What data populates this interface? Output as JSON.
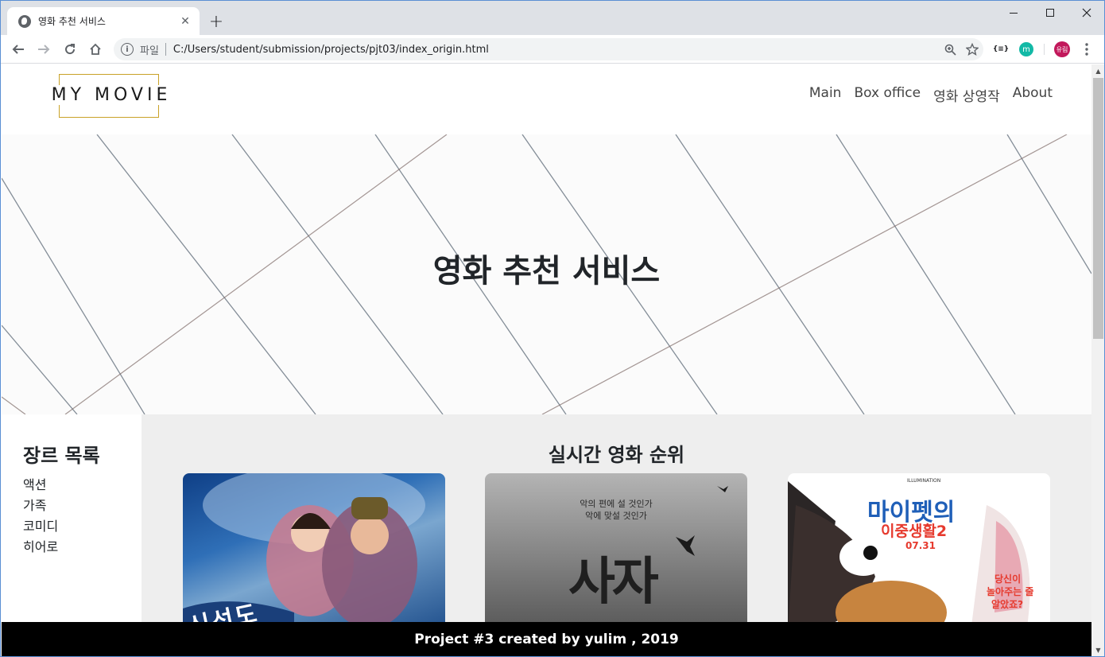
{
  "browser": {
    "tab_title": "영화 추천 서비스",
    "tab_close": "✕",
    "new_tab": "+",
    "omnibox_scheme": "파일",
    "url": "C:/Users/student/submission/projects/pjt03/index_origin.html",
    "extensions": {
      "json_viewer": "{≡}",
      "m_ext": "m",
      "profile": "유림"
    }
  },
  "site": {
    "logo": "MY MOVIE",
    "nav": [
      "Main",
      "Box office",
      "영화 상영작",
      "About"
    ],
    "hero_title": "영화 추천 서비스"
  },
  "sidebar": {
    "title": "장르 목록",
    "genres": [
      "액션",
      "가족",
      "코미디",
      "히어로"
    ]
  },
  "ranking": {
    "title": "실시간 영화 순위",
    "posters": [
      {
        "text_fragment": "신선도"
      },
      {
        "top_text_1": "악의 편에 설 것인가",
        "top_text_2": "악에 맞설 것인가",
        "big_text": "사자"
      },
      {
        "brand": "ILLUMINATION",
        "title_1": "마이펫의",
        "title_2": "이중생활2",
        "date": "07.31",
        "tagline_1": "당신이",
        "tagline_2": "놀아주는 줄",
        "tagline_3": "알았죠?"
      }
    ]
  },
  "footer": {
    "text": "Project #3 created by yulim , 2019"
  }
}
